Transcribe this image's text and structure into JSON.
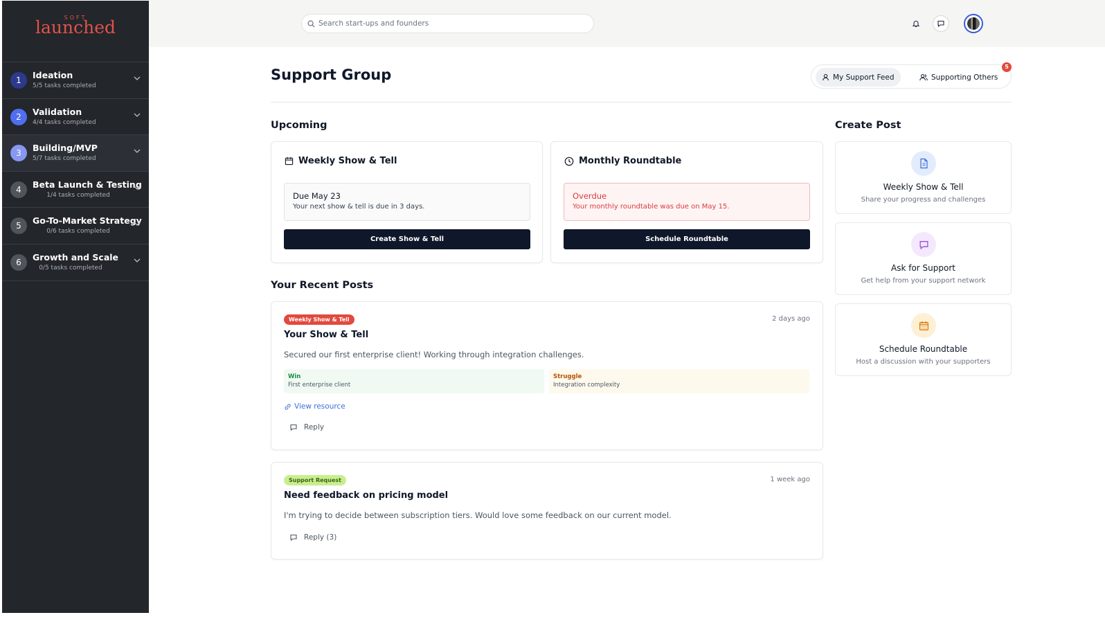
{
  "brand": {
    "small": "SOFT",
    "name": "launched"
  },
  "sidebar": {
    "stages": [
      {
        "num": "1",
        "title": "Ideation",
        "sub": "5/5 tasks completed",
        "color": "#2d3a8c"
      },
      {
        "num": "2",
        "title": "Validation",
        "sub": "4/4 tasks completed",
        "color": "#4f6ef0"
      },
      {
        "num": "3",
        "title": "Building/MVP",
        "sub": "5/7 tasks completed",
        "color": "#8797f2"
      },
      {
        "num": "4",
        "title": "Beta Launch & Testing",
        "sub": "1/4 tasks completed",
        "color": "#50545b"
      },
      {
        "num": "5",
        "title": "Go-To-Market Strategy",
        "sub": "0/6 tasks completed",
        "color": "#50545b"
      },
      {
        "num": "6",
        "title": "Growth and Scale",
        "sub": "0/5 tasks completed",
        "color": "#50545b"
      }
    ]
  },
  "search": {
    "placeholder": "Search start-ups and founders"
  },
  "page": {
    "title": "Support Group"
  },
  "toggle": {
    "my_feed": "My Support Feed",
    "supporting": "Supporting Others",
    "badge": "5"
  },
  "upcoming": {
    "heading": "Upcoming",
    "show_tell": {
      "title": "Weekly Show & Tell",
      "line1": "Due May 23",
      "line2": "Your next show & tell is due in 3 days.",
      "button": "Create Show & Tell"
    },
    "roundtable": {
      "title": "Monthly Roundtable",
      "line1": "Overdue",
      "line2": "Your monthly roundtable was due on May 15.",
      "button": "Schedule Roundtable"
    }
  },
  "recent": {
    "heading": "Your Recent Posts",
    "posts": [
      {
        "tag": "Weekly Show & Tell",
        "ago": "2 days ago",
        "title": "Your Show & Tell",
        "body": "Secured our first enterprise client! Working through integration challenges.",
        "win_label": "Win",
        "win_text": "First enterprise client",
        "struggle_label": "Struggle",
        "struggle_text": "Integration complexity",
        "resource": "View resource",
        "reply": "Reply"
      },
      {
        "tag": "Support Request",
        "ago": "1 week ago",
        "title": "Need feedback on pricing model",
        "body": "I'm trying to decide between subscription tiers. Would love some feedback on our current model.",
        "reply": "Reply (3)"
      }
    ]
  },
  "create": {
    "heading": "Create Post",
    "items": [
      {
        "title": "Weekly Show & Tell",
        "sub": "Share your progress and challenges",
        "icon": "document-icon"
      },
      {
        "title": "Ask for Support",
        "sub": "Get help from your support network",
        "icon": "chat-icon"
      },
      {
        "title": "Schedule Roundtable",
        "sub": "Host a discussion with your supporters",
        "icon": "calendar-icon"
      }
    ]
  },
  "colors": {
    "sidebar": "#23262b",
    "brand": "#e0534a",
    "dark_button": "#0f172a",
    "overdue": "#dc3b3b",
    "link": "#3b6fd9"
  }
}
